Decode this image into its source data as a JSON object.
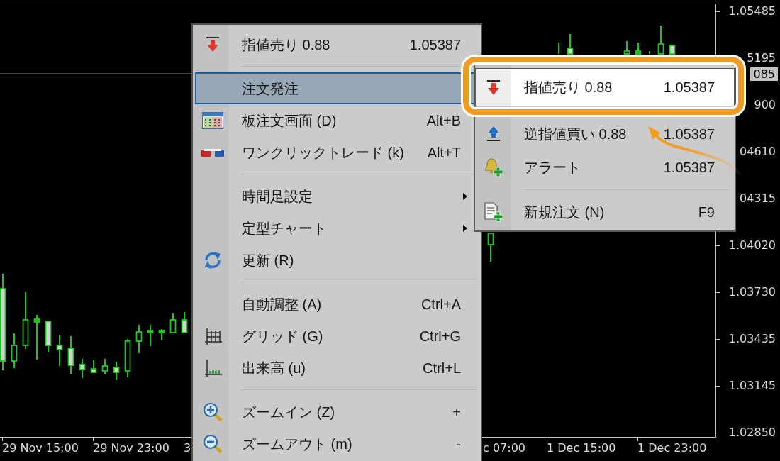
{
  "chart": {
    "price_axis": {
      "labels": [
        "1.05485",
        "5195",
        "900",
        "04610",
        "04315",
        "1.04020",
        "1.03730",
        "1.03435",
        "1.03145",
        "1.02850"
      ]
    },
    "price_tag": "085",
    "time_axis": {
      "labels": [
        "29 Nov 15:00",
        "29 Nov 23:00",
        "3",
        "c 07:00",
        "1 Dec 15:00",
        "1 Dec 23:00"
      ]
    }
  },
  "context_menu": {
    "items": [
      {
        "kind": "item",
        "label": "指値売り 0.88",
        "price": "1.05387",
        "selected": false,
        "submenu_arrow": false
      },
      {
        "kind": "separator"
      },
      {
        "kind": "item",
        "label": "注文発注",
        "selected": true,
        "submenu_arrow": false
      },
      {
        "kind": "item",
        "label": "板注文画面 (D)",
        "shortcut": "Alt+B",
        "selected": false,
        "submenu_arrow": false
      },
      {
        "kind": "item",
        "label": "ワンクリックトレード (k)",
        "shortcut": "Alt+T",
        "selected": false,
        "submenu_arrow": false
      },
      {
        "kind": "separator"
      },
      {
        "kind": "item",
        "label": "時間足設定",
        "selected": false,
        "submenu_arrow": true
      },
      {
        "kind": "item",
        "label": "定型チャート",
        "selected": false,
        "submenu_arrow": true
      },
      {
        "kind": "item",
        "label": "更新 (R)",
        "selected": false,
        "submenu_arrow": false
      },
      {
        "kind": "separator"
      },
      {
        "kind": "item",
        "label": "自動調整 (A)",
        "shortcut": "Ctrl+A",
        "selected": false,
        "submenu_arrow": false
      },
      {
        "kind": "item",
        "label": "グリッド (G)",
        "shortcut": "Ctrl+G",
        "selected": false,
        "submenu_arrow": false
      },
      {
        "kind": "item",
        "label": "出来高 (u)",
        "shortcut": "Ctrl+L",
        "selected": false,
        "submenu_arrow": false
      },
      {
        "kind": "separator"
      },
      {
        "kind": "item",
        "label": "ズームイン (Z)",
        "shortcut": "+",
        "selected": false,
        "submenu_arrow": false
      },
      {
        "kind": "item",
        "label": "ズームアウト (m)",
        "shortcut": "-",
        "selected": false,
        "submenu_arrow": false
      }
    ]
  },
  "submenu": {
    "items": [
      {
        "kind": "item",
        "label": "指値売り 0.88",
        "price": "1.05387",
        "selected": true
      },
      {
        "kind": "item",
        "label": "逆指値買い 0.88",
        "price": "1.05387",
        "selected": false
      },
      {
        "kind": "item",
        "label": "アラート",
        "price": "1.05387",
        "selected": false
      },
      {
        "kind": "separator"
      },
      {
        "kind": "item",
        "label": "新規注文 (N)",
        "shortcut": "F9",
        "selected": false
      }
    ]
  }
}
